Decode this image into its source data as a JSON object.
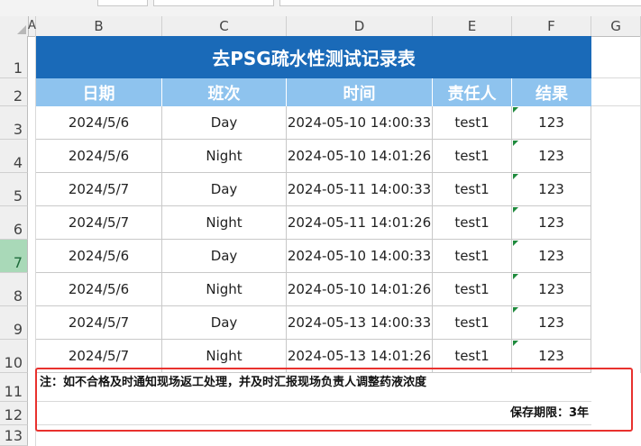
{
  "columns": [
    "A",
    "B",
    "C",
    "D",
    "E",
    "F",
    "G"
  ],
  "rows": [
    "1",
    "2",
    "3",
    "4",
    "5",
    "6",
    "7",
    "8",
    "9",
    "10",
    "11",
    "12",
    "13"
  ],
  "selected_row": "7",
  "title": "去PSG疏水性测试记录表",
  "headers": [
    "日期",
    "班次",
    "时间",
    "责任人",
    "结果"
  ],
  "records": [
    {
      "date": "2024/5/6",
      "shift": "Day",
      "time": "2024-05-10 14:00:33",
      "person": "test1",
      "result": "123"
    },
    {
      "date": "2024/5/6",
      "shift": "Night",
      "time": "2024-05-10 14:01:26",
      "person": "test1",
      "result": "123"
    },
    {
      "date": "2024/5/7",
      "shift": "Day",
      "time": "2024-05-11 14:00:33",
      "person": "test1",
      "result": "123"
    },
    {
      "date": "2024/5/7",
      "shift": "Night",
      "time": "2024-05-11 14:01:26",
      "person": "test1",
      "result": "123"
    },
    {
      "date": "2024/5/6",
      "shift": "Day",
      "time": "2024-05-10 14:00:33",
      "person": "test1",
      "result": "123"
    },
    {
      "date": "2024/5/6",
      "shift": "Night",
      "time": "2024-05-10 14:01:26",
      "person": "test1",
      "result": "123"
    },
    {
      "date": "2024/5/7",
      "shift": "Day",
      "time": "2024-05-13 14:00:33",
      "person": "test1",
      "result": "123"
    },
    {
      "date": "2024/5/7",
      "shift": "Night",
      "time": "2024-05-13 14:01:26",
      "person": "test1",
      "result": "123"
    }
  ],
  "note": "注：如不合格及时通知现场返工处理，并及时汇报现场负责人调整药液浓度",
  "retention": "保存期限：3年",
  "colors": {
    "title_bg": "#1a6ab8",
    "header_bg": "#8ec3ee",
    "highlight": "#e8312e",
    "error_marker": "#1e8a3c"
  }
}
